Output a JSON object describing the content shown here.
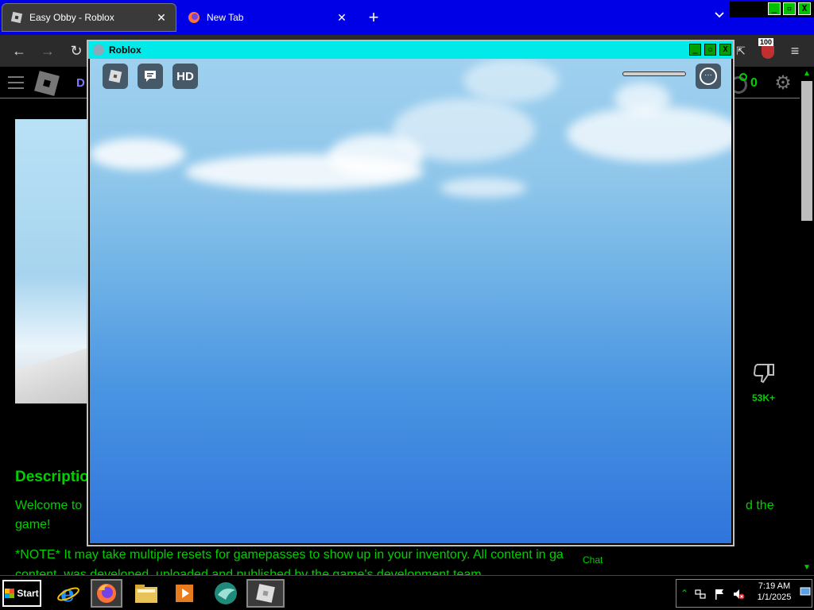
{
  "browser": {
    "tabs": [
      {
        "title": "Easy Obby - Roblox",
        "active": true,
        "favicon": "roblox-favicon"
      },
      {
        "title": "New Tab",
        "active": false,
        "favicon": "firefox-favicon"
      }
    ],
    "new_tab_glyph": "+",
    "tab_list_glyph": "⌄",
    "toolbar": {
      "back": "←",
      "forward": "→",
      "reload": "↻",
      "menu": "≡"
    },
    "extension_badge": "100",
    "window_buttons": [
      "_",
      "▫",
      "X"
    ]
  },
  "page": {
    "nav_text": "D",
    "robux_count": "0",
    "dislike_count": "53K+",
    "description_heading": "Descriptio",
    "description_line1": "Welcome to",
    "description_line1_end": "d the",
    "description_line2": "game!",
    "description_note": "*NOTE* It may take multiple resets for gamepasses to show up in your inventory. All content in ga",
    "description_note_cut": "content, was developed, uploaded and published by the game's development team.",
    "chat_label": "Chat",
    "text_color": "#00d000"
  },
  "game_window": {
    "title": "Roblox",
    "controls": [
      "_",
      "▫",
      "X"
    ],
    "hud": {
      "buttons": [
        "roblox-menu-icon",
        "chat-icon",
        "hd-icon"
      ],
      "hd_label": "HD",
      "more_label": "···"
    }
  },
  "taskbar": {
    "start_label": "Start",
    "apps": [
      "internet-explorer-icon",
      "firefox-icon",
      "file-explorer-icon",
      "media-player-icon",
      "roblox-studio-icon",
      "roblox-player-icon"
    ],
    "clock_time": "7:19 AM",
    "clock_date": "1/1/2025"
  }
}
